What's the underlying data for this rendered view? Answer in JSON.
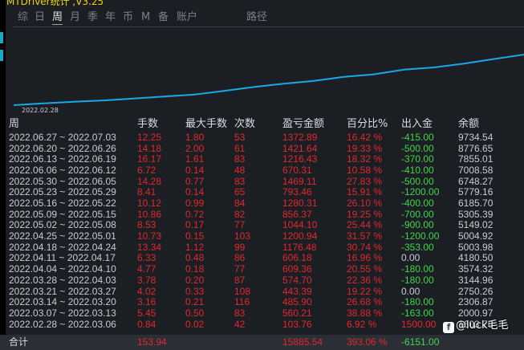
{
  "window": {
    "title": "MTDriver统计  ,V3.25"
  },
  "menu": {
    "items": [
      {
        "label": "综"
      },
      {
        "label": "日"
      },
      {
        "label": "周"
      },
      {
        "label": "月"
      },
      {
        "label": "季"
      },
      {
        "label": "年"
      },
      {
        "label": "币"
      },
      {
        "label": "M"
      },
      {
        "label": "备"
      },
      {
        "label": "账户"
      },
      {
        "label": "路径"
      }
    ],
    "active": "周"
  },
  "chart": {
    "start_date_label": "2022.02.28",
    "line_color": "#1aa7e6"
  },
  "chart_data": {
    "type": "line",
    "x": [
      "2022.02.28",
      "2022.03.07",
      "2022.03.14",
      "2022.03.21",
      "2022.03.28",
      "2022.04.04",
      "2022.04.11",
      "2022.04.18",
      "2022.04.25",
      "2022.05.02",
      "2022.05.09",
      "2022.05.16",
      "2022.05.23",
      "2022.05.30",
      "2022.06.06",
      "2022.06.13",
      "2022.06.20",
      "2022.06.27"
    ],
    "y": [
      103.76,
      664.0,
      1149.9,
      1593.3,
      2168.0,
      2777.4,
      3383.6,
      4560.0,
      5760.9,
      6805.0,
      7661.4,
      8941.7,
      9735.1,
      11204.2,
      11874.5,
      13090.9,
      14512.6,
      15885.5
    ],
    "title": "",
    "xlabel": "",
    "ylabel": ""
  },
  "table": {
    "headers": {
      "week": "周",
      "trades": "手数",
      "max_trades": "最大手数",
      "count": "次数",
      "pnl": "盈亏金额",
      "pct": "百分比%",
      "io": "出入金",
      "balance": "余额"
    },
    "rows": [
      {
        "week": "2022.06.27 ~ 2022.07.03",
        "trades": "12.25",
        "max": "1.80",
        "count": "53",
        "pnl": "1372.89",
        "pct": "16.42 %",
        "io": "-415.00",
        "balance": "9734.54"
      },
      {
        "week": "2022.06.20 ~ 2022.06.26",
        "trades": "14.18",
        "max": "2.00",
        "count": "61",
        "pnl": "1421.64",
        "pct": "19.33 %",
        "io": "-500.00",
        "balance": "8776.65"
      },
      {
        "week": "2022.06.13 ~ 2022.06.19",
        "trades": "16.17",
        "max": "1.61",
        "count": "83",
        "pnl": "1216.43",
        "pct": "18.32 %",
        "io": "-370.00",
        "balance": "7855.01"
      },
      {
        "week": "2022.06.06 ~ 2022.06.12",
        "trades": "6.72",
        "max": "0.14",
        "count": "48",
        "pnl": "670.31",
        "pct": "10.58 %",
        "io": "-410.00",
        "balance": "7008.58"
      },
      {
        "week": "2022.05.30 ~ 2022.06.05",
        "trades": "14.28",
        "max": "0.77",
        "count": "83",
        "pnl": "1469.11",
        "pct": "27.83 %",
        "io": "-500.00",
        "balance": "6748.27"
      },
      {
        "week": "2022.05.23 ~ 2022.05.29",
        "trades": "8.41",
        "max": "0.14",
        "count": "65",
        "pnl": "793.46",
        "pct": "15.91 %",
        "io": "-1200.00",
        "balance": "5779.16"
      },
      {
        "week": "2022.05.16 ~ 2022.05.22",
        "trades": "10.12",
        "max": "0.99",
        "count": "84",
        "pnl": "1280.31",
        "pct": "26.10 %",
        "io": "-400.00",
        "balance": "6185.70"
      },
      {
        "week": "2022.05.09 ~ 2022.05.15",
        "trades": "10.86",
        "max": "0.72",
        "count": "82",
        "pnl": "856.37",
        "pct": "19.25 %",
        "io": "-700.00",
        "balance": "5305.39"
      },
      {
        "week": "2022.05.02 ~ 2022.05.08",
        "trades": "8.53",
        "max": "0.17",
        "count": "77",
        "pnl": "1044.10",
        "pct": "25.44 %",
        "io": "-900.00",
        "balance": "5149.02"
      },
      {
        "week": "2022.04.25 ~ 2022.05.01",
        "trades": "10.73",
        "max": "0.15",
        "count": "103",
        "pnl": "1200.94",
        "pct": "31.57 %",
        "io": "-1200.00",
        "balance": "5004.92"
      },
      {
        "week": "2022.04.18 ~ 2022.04.24",
        "trades": "13.34",
        "max": "1.12",
        "count": "99",
        "pnl": "1176.48",
        "pct": "30.74 %",
        "io": "-353.00",
        "balance": "5003.98"
      },
      {
        "week": "2022.04.11 ~ 2022.04.17",
        "trades": "6.33",
        "max": "0.48",
        "count": "86",
        "pnl": "606.18",
        "pct": "16.96 %",
        "io": "0.00",
        "balance": "4180.50"
      },
      {
        "week": "2022.04.04 ~ 2022.04.10",
        "trades": "4.77",
        "max": "0.18",
        "count": "77",
        "pnl": "609.36",
        "pct": "20.55 %",
        "io": "-180.00",
        "balance": "3574.32"
      },
      {
        "week": "2022.03.28 ~ 2022.04.03",
        "trades": "3.78",
        "max": "0.20",
        "count": "87",
        "pnl": "574.70",
        "pct": "22.36 %",
        "io": "-180.00",
        "balance": "3144.96"
      },
      {
        "week": "2022.03.21 ~ 2022.03.27",
        "trades": "4.02",
        "max": "0.33",
        "count": "108",
        "pnl": "443.39",
        "pct": "19.22 %",
        "io": "0.00",
        "balance": "2750.26"
      },
      {
        "week": "2022.03.14 ~ 2022.03.20",
        "trades": "3.16",
        "max": "0.21",
        "count": "116",
        "pnl": "485.90",
        "pct": "26.68 %",
        "io": "-180.00",
        "balance": "2306.87"
      },
      {
        "week": "2022.03.07 ~ 2022.03.13",
        "trades": "5.45",
        "max": "0.50",
        "count": "83",
        "pnl": "560.21",
        "pct": "38.88 %",
        "io": "-163.00",
        "balance": "2000.97"
      },
      {
        "week": "2022.02.28 ~ 2022.03.06",
        "trades": "0.84",
        "max": "0.02",
        "count": "42",
        "pnl": "103.76",
        "pct": "6.92 %",
        "io": "1500.00",
        "balance": "1603.76"
      }
    ],
    "total": {
      "label": "合计",
      "trades": "153.94",
      "pnl": "15885.54",
      "pct": "393.06 %",
      "io": "-6151.00"
    }
  },
  "watermark": {
    "text": "@luck毛毛",
    "logo_glyph": "f"
  },
  "colors": {
    "positive": "#e0282c",
    "negative": "#3fd64a",
    "neutral": "#c9cdd2",
    "title": "#f0d400"
  }
}
